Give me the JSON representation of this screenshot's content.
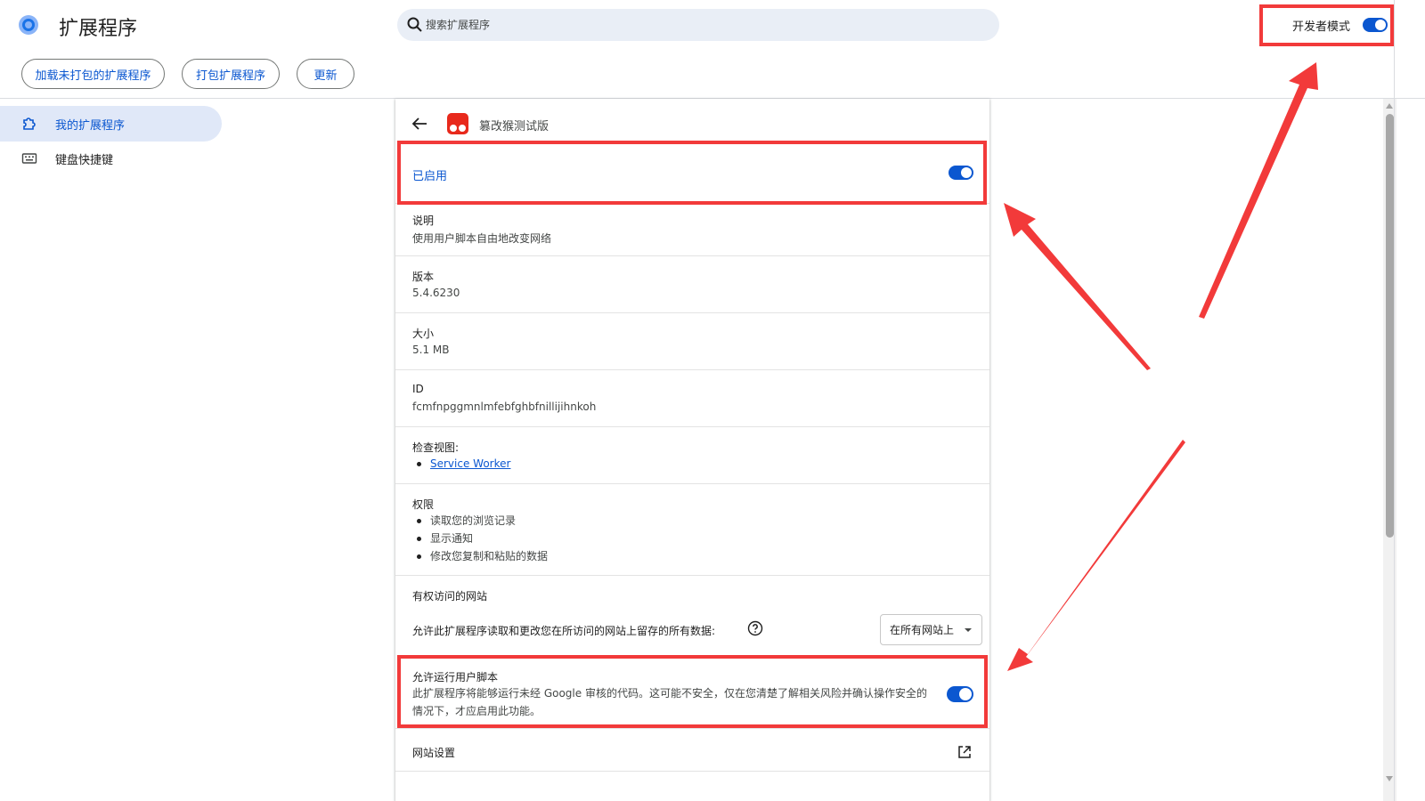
{
  "header": {
    "title": "扩展程序",
    "search_placeholder": "搜索扩展程序",
    "dev_mode_label": "开发者模式",
    "dev_mode_on": true,
    "buttons": {
      "load_unpacked": "加载未打包的扩展程序",
      "pack": "打包扩展程序",
      "update": "更新"
    }
  },
  "sidebar": {
    "items": [
      {
        "label": "我的扩展程序",
        "icon": "puzzle-icon",
        "active": true
      },
      {
        "label": "键盘快捷键",
        "icon": "keyboard-icon",
        "active": false
      }
    ]
  },
  "detail": {
    "extension_name": "篡改猴测试版",
    "enabled_label": "已启用",
    "enabled_on": true,
    "description_label": "说明",
    "description_value": "使用用户脚本自由地改变网络",
    "version_label": "版本",
    "version_value": "5.4.6230",
    "size_label": "大小",
    "size_value": "5.1 MB",
    "id_label": "ID",
    "id_value": "fcmfnpggmnlmfebfghbfnillijihnkoh",
    "inspect_label": "检查视图:",
    "inspect_items": [
      "Service Worker"
    ],
    "permissions_label": "权限",
    "permissions": [
      "读取您的浏览记录",
      "显示通知",
      "修改您复制和粘贴的数据"
    ],
    "site_access_label": "有权访问的网站",
    "site_access_text": "允许此扩展程序读取和更改您在所访问的网站上留存的所有数据:",
    "site_access_select": "在所有网站上",
    "user_scripts_label": "允许运行用户脚本",
    "user_scripts_desc": "此扩展程序将能够运行未经 Google 审核的代码。这可能不安全，仅在您清楚了解相关风险并确认操作安全的情况下，才应启用此功能。",
    "user_scripts_on": true,
    "site_settings_label": "网站设置"
  },
  "colors": {
    "accent": "#0b57d0",
    "annotation_red": "#f23a3a",
    "active_nav_bg": "#e0e8f8",
    "search_bg": "#e9eef6"
  }
}
